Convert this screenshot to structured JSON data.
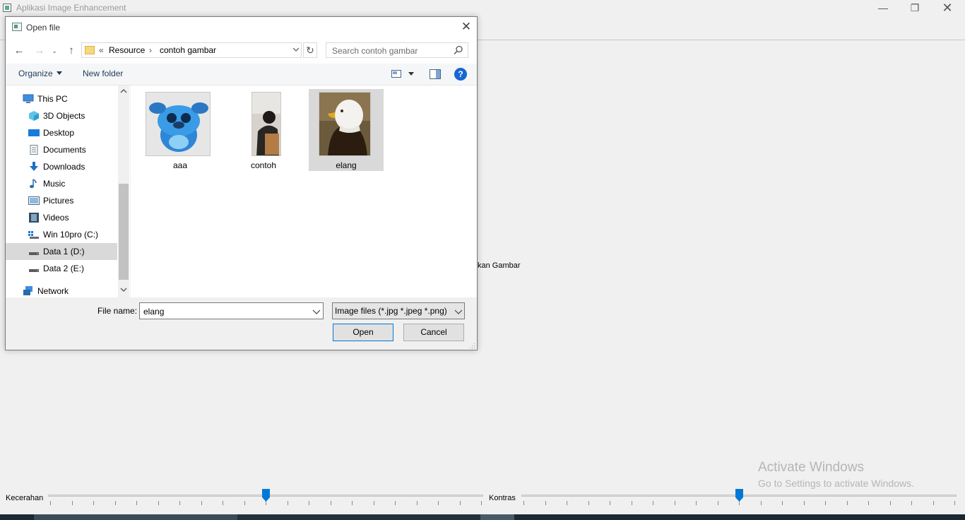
{
  "app": {
    "title": "Aplikasi Image Enhancement",
    "partial_label": "kan Gambar",
    "watermark_title": "Activate Windows",
    "watermark_sub": "Go to Settings to activate Windows.",
    "slider_brightness_label": "Kecerahan",
    "slider_contrast_label": "Kontras",
    "slider_brightness_value": 0.5,
    "slider_contrast_value": 0.5
  },
  "dialog": {
    "title": "Open file",
    "breadcrumb": {
      "overflow": "«",
      "items": [
        "Resource",
        "contoh gambar"
      ],
      "separator": "›"
    },
    "search_placeholder": "Search contoh gambar",
    "toolbar": {
      "organize": "Organize",
      "new_folder": "New folder",
      "help": "?"
    },
    "nav_tree": [
      {
        "label": "This PC",
        "icon": "pc-icon"
      },
      {
        "label": "3D Objects",
        "icon": "cube-icon"
      },
      {
        "label": "Desktop",
        "icon": "desktop-icon"
      },
      {
        "label": "Documents",
        "icon": "document-icon"
      },
      {
        "label": "Downloads",
        "icon": "download-icon"
      },
      {
        "label": "Music",
        "icon": "music-icon"
      },
      {
        "label": "Pictures",
        "icon": "pictures-icon"
      },
      {
        "label": "Videos",
        "icon": "video-icon"
      },
      {
        "label": "Win 10pro (C:)",
        "icon": "windows-drive-icon"
      },
      {
        "label": "Data 1 (D:)",
        "icon": "drive-icon",
        "selected": true
      },
      {
        "label": "Data 2 (E:)",
        "icon": "drive-icon"
      },
      {
        "label": "Network",
        "icon": "network-icon"
      }
    ],
    "files": [
      {
        "name": "aaa",
        "icon": "stitch-plush-thumbnail"
      },
      {
        "name": "contoh",
        "icon": "person-photo-thumbnail"
      },
      {
        "name": "elang",
        "icon": "bald-eagle-thumbnail",
        "selected": true
      }
    ],
    "file_name_label": "File name:",
    "file_name_value": "elang",
    "file_type": "Image files (*.jpg *.jpeg *.png)",
    "open_button": "Open",
    "cancel_button": "Cancel"
  },
  "colors": {
    "selection": "#d9d9d9",
    "accent": "#0078d7",
    "help": "#1766d3",
    "link_text": "#1e395b"
  }
}
